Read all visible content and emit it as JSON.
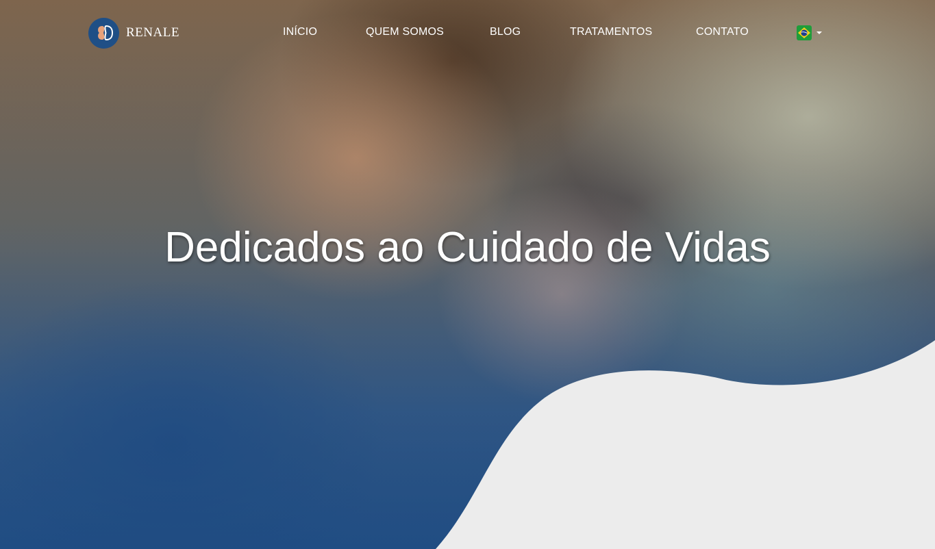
{
  "brand": {
    "name": "RENALE",
    "logo_icon": "kidney-logo-icon"
  },
  "nav": {
    "items": [
      {
        "label": "INÍCIO"
      },
      {
        "label": "QUEM SOMOS"
      },
      {
        "label": "BLOG"
      },
      {
        "label": "TRATAMENTOS"
      },
      {
        "label": "CONTATO"
      }
    ],
    "language": {
      "icon": "brazil-flag-icon",
      "caret_icon": "caret-down-icon"
    }
  },
  "hero": {
    "headline": "Dedicados ao Cuidado de Vidas"
  },
  "colors": {
    "brand_blue": "#1f4f86",
    "wave_fill": "#ececec",
    "nav_text": "#ffffff"
  }
}
